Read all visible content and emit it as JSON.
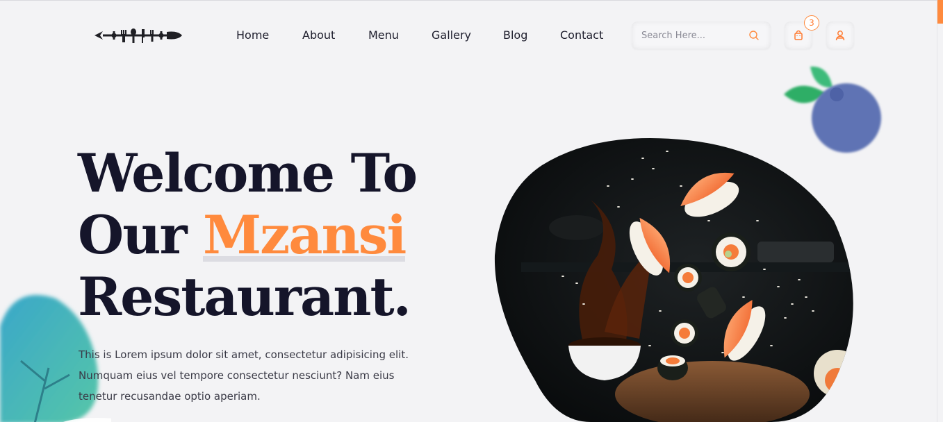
{
  "nav": {
    "home": "Home",
    "about": "About",
    "menu": "Menu",
    "gallery": "Gallery",
    "blog": "Blog",
    "contact": "Contact"
  },
  "search": {
    "placeholder": "Search Here..."
  },
  "cart": {
    "count": "3"
  },
  "hero": {
    "line1": "Welcome To",
    "line2_prefix": "Our",
    "line2_highlight": "Mzansi",
    "line3": "Restaurant.",
    "description_line1": "This is Lorem ipsum dolor sit amet, consectetur adipisicing elit.",
    "description_line2": "Numquam eius vel tempore consectetur nesciunt? Nam eius",
    "description_line3": "tenetur recusandae optio aperiam."
  },
  "colors": {
    "accent": "#ff8a3d",
    "heading": "#15152a",
    "background": "#f3f3f5"
  },
  "icons": {
    "logo": "cutlery-fish-logo",
    "search": "search-icon",
    "cart": "shopping-bag-icon",
    "user": "user-icon"
  }
}
